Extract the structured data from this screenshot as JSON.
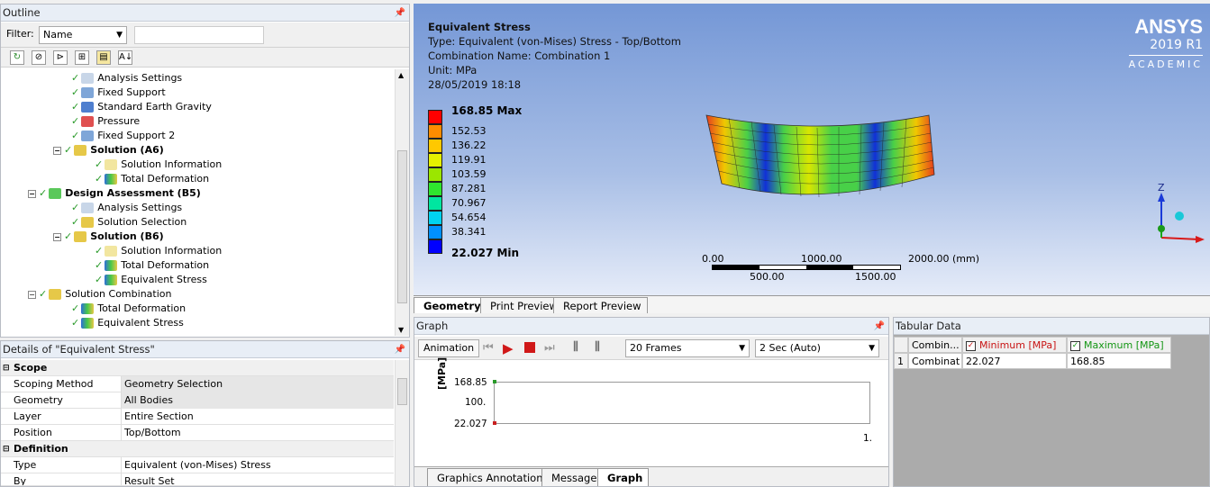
{
  "outline": {
    "title": "Outline",
    "filter_label": "Filter:",
    "filter_value": "Name",
    "search_value": "",
    "tree": [
      {
        "label": "Analysis Settings"
      },
      {
        "label": "Fixed Support"
      },
      {
        "label": "Standard Earth Gravity"
      },
      {
        "label": "Pressure"
      },
      {
        "label": "Fixed Support 2"
      },
      {
        "label": "Solution (A6)"
      },
      {
        "label": "Solution Information"
      },
      {
        "label": "Total Deformation"
      },
      {
        "label": "Design Assessment (B5)"
      },
      {
        "label": "Analysis Settings"
      },
      {
        "label": "Solution Selection"
      },
      {
        "label": "Solution (B6)"
      },
      {
        "label": "Solution Information"
      },
      {
        "label": "Total Deformation"
      },
      {
        "label": "Equivalent Stress"
      },
      {
        "label": "Solution Combination"
      },
      {
        "label": "Total Deformation"
      },
      {
        "label": "Equivalent Stress"
      }
    ]
  },
  "details": {
    "title": "Details of \"Equivalent Stress\"",
    "rows": [
      {
        "label": "Scope"
      },
      {
        "label": "Scoping Method",
        "value": "Geometry Selection"
      },
      {
        "label": "Geometry",
        "value": "All Bodies"
      },
      {
        "label": "Layer",
        "value": "Entire Section"
      },
      {
        "label": "Position",
        "value": "Top/Bottom"
      },
      {
        "label": "Definition"
      },
      {
        "label": "Type",
        "value": "Equivalent (von-Mises) Stress"
      },
      {
        "label": "By",
        "value": "Result Set"
      }
    ]
  },
  "viewport": {
    "title": "Equivalent Stress",
    "type_line": "Type: Equivalent (von-Mises) Stress - Top/Bottom",
    "combination_line": "Combination Name: Combination 1",
    "unit_line": "Unit: MPa",
    "date_line": "28/05/2019 18:18",
    "logo_brand": "ANSYS",
    "logo_version": "2019 R1",
    "logo_edition": "ACADEMIC",
    "legend": [
      {
        "label": "168.85 Max",
        "color": "#ff0000"
      },
      {
        "label": "152.53",
        "color": "#ff8c00"
      },
      {
        "label": "136.22",
        "color": "#ffc800"
      },
      {
        "label": "119.91",
        "color": "#e6f000"
      },
      {
        "label": "103.59",
        "color": "#9be600"
      },
      {
        "label": "87.281",
        "color": "#2ee62e"
      },
      {
        "label": "70.967",
        "color": "#00e6a0"
      },
      {
        "label": "54.654",
        "color": "#00d2f0"
      },
      {
        "label": "38.341",
        "color": "#0090ff"
      },
      {
        "label": "22.027 Min",
        "color": "#0000ff"
      }
    ],
    "scale_top": [
      "0.00",
      "1000.00",
      "2000.00 (mm)"
    ],
    "scale_bottom": [
      "500.00",
      "1500.00"
    ],
    "tabs": [
      "Geometry",
      "Print Preview",
      "Report Preview"
    ]
  },
  "graph": {
    "title": "Graph",
    "animation_label": "Animation",
    "frames": "20 Frames",
    "duration": "2 Sec (Auto)",
    "y_unit": "[MPa]",
    "y_ticks": [
      "168.85",
      "100.",
      "22.027"
    ],
    "x_end": "1.",
    "tabs": [
      "Graphics Annotations",
      "Messages",
      "Graph"
    ]
  },
  "tabular": {
    "title": "Tabular Data",
    "headers": [
      "Combin...",
      "Minimum [MPa]",
      "Maximum [MPa]"
    ],
    "rows": [
      {
        "index": "1",
        "combination": "Combinat",
        "min": "22.027",
        "max": "168.85"
      }
    ]
  }
}
